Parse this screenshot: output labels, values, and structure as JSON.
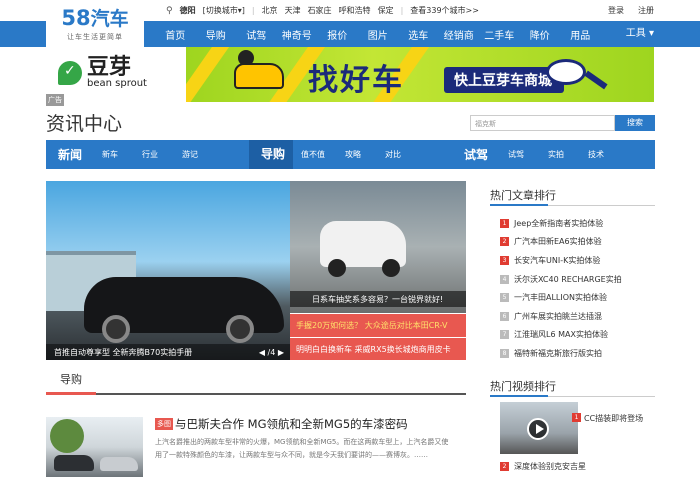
{
  "header": {
    "logo_num": "58",
    "logo_car": "汽车",
    "slogan": "让车生活更简单",
    "city_current": "德阳",
    "city_switch": "[切换城市▾]",
    "cities": [
      "北京",
      "天津",
      "石家庄",
      "呼和浩特",
      "保定"
    ],
    "all_cities": "查看339个城市>>",
    "login": "登录",
    "register": "注册"
  },
  "nav": {
    "items": [
      "首页",
      "导购",
      "试驾",
      "神奇号",
      "报价",
      "图片",
      "选车",
      "经销商",
      "二手车",
      "降价",
      "用品"
    ],
    "tools": "工具 ▾"
  },
  "banner": {
    "brand_cn": "豆芽",
    "brand_en": "bean sprout",
    "ad_label": "广告",
    "headline": "找好车",
    "pill": "快上豆芽车商城"
  },
  "section": {
    "title": "资讯中心",
    "search_placeholder": "福克斯",
    "search_button": "搜索"
  },
  "categories": [
    {
      "head": "新闻",
      "active": false,
      "subs": [
        "新车",
        "行业",
        "游记"
      ]
    },
    {
      "head": "导购",
      "active": true,
      "subs": [
        "值不值",
        "攻略",
        "对比"
      ]
    },
    {
      "head": "试驾",
      "active": false,
      "subs": [
        "试驾",
        "实拍",
        "技术"
      ]
    }
  ],
  "feature": {
    "main_caption": "首推自动尊享型 全新奔腾B70实拍手册",
    "pager": "◀ /4 ▶",
    "side_caption": "日系车抽奖系多容易？一台锐界就好!",
    "red1": "手握20万如何选？ 大众途岳对比本田CR-V",
    "red2": "明明白白换新车 采威RX5换长城炮商用皮卡"
  },
  "guide": {
    "tab": "导购",
    "article_badge": "多图",
    "article_title": "与巴斯夫合作 MG领航和全新MG5的车漆密码",
    "article_desc": "上汽名爵推出的两款车型非常的火爆，MG领航和全新MG5。而在这两款车型上，上汽名爵又使用了一款特殊颜色的车漆，让两款车型与众不同，就是今天我们要讲的——赛博灰。……"
  },
  "hot_articles": {
    "title": "热门文章排行",
    "items": [
      {
        "num": "1",
        "text": "Jeep全新指南者实拍体验"
      },
      {
        "num": "2",
        "text": "广汽本田新EA6实拍体验"
      },
      {
        "num": "3",
        "text": "长安汽车UNI-K实拍体验"
      },
      {
        "num": "4",
        "text": "沃尔沃XC40 RECHARGE实拍"
      },
      {
        "num": "5",
        "text": "一汽丰田ALLION实拍体验"
      },
      {
        "num": "6",
        "text": "广州车展实拍眺兰达插混"
      },
      {
        "num": "7",
        "text": "江淮瑞风L6 MAX实拍体验"
      },
      {
        "num": "8",
        "text": "福特新福克斯旅行版实拍"
      }
    ]
  },
  "hot_videos": {
    "title": "热门视频排行",
    "items": [
      {
        "num": "1",
        "text": "CC描装即将登场"
      },
      {
        "num": "2",
        "text": "深度体验别克安吉星"
      }
    ]
  }
}
